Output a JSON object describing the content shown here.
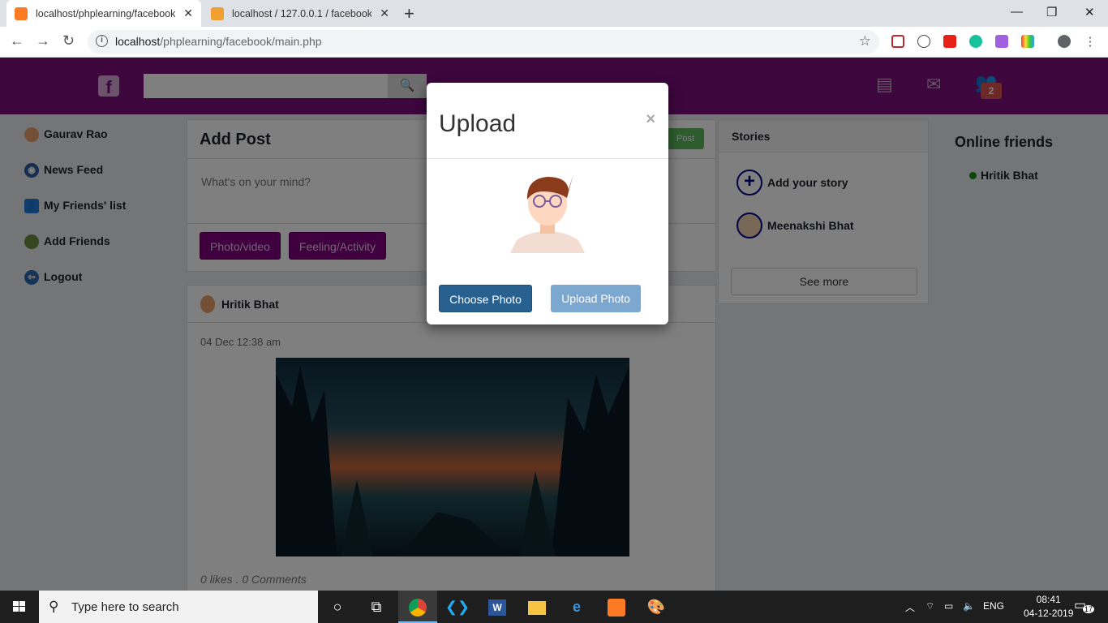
{
  "browser": {
    "tabs": [
      {
        "title": "localhost/phplearning/facebook/",
        "active": true
      },
      {
        "title": "localhost / 127.0.0.1 / facebook /",
        "active": false
      }
    ],
    "url_host": "localhost",
    "url_path": "/phplearning/facebook/main.php"
  },
  "header": {
    "badge_count": "2"
  },
  "sidebar": {
    "items": [
      {
        "label": "Gaurav Rao"
      },
      {
        "label": "News Feed"
      },
      {
        "label": "My Friends' list"
      },
      {
        "label": "Add Friends"
      },
      {
        "label": "Logout"
      }
    ]
  },
  "add_post": {
    "title": "Add Post",
    "post_label": "Post",
    "placeholder": "What's on your mind?",
    "photo_label": "Photo/video",
    "feeling_label": "Feeling/Activity"
  },
  "post": {
    "author": "Hritik Bhat",
    "date": "04 Dec 12:38 am",
    "stats": "0 likes . 0 Comments"
  },
  "stories": {
    "title": "Stories",
    "add_label": "Add your story",
    "story_user": "Meenakshi Bhat",
    "see_more": "See more"
  },
  "online": {
    "title": "Online friends",
    "friends": [
      {
        "name": "Hritik Bhat"
      }
    ]
  },
  "modal": {
    "title": "Upload",
    "close": "×",
    "choose_label": "Choose Photo",
    "upload_label": "Upload Photo"
  },
  "taskbar": {
    "search_placeholder": "Type here to search",
    "lang": "ENG",
    "time": "08:41",
    "date": "04-12-2019",
    "notifications": "17"
  },
  "colors": {
    "brand_purple": "#7a0c7a",
    "primary_blue": "#286090",
    "success_green": "#5cb85c"
  }
}
